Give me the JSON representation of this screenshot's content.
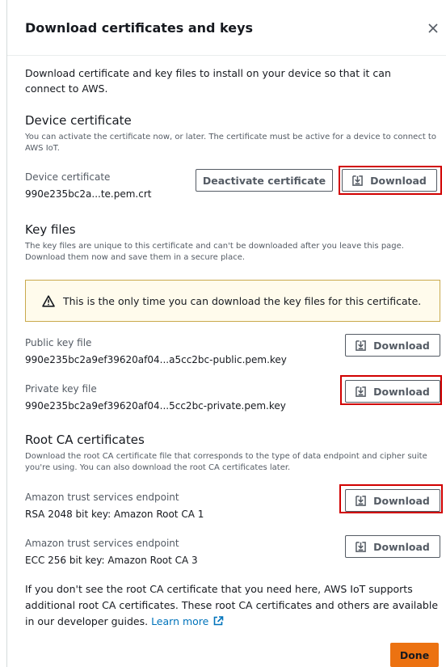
{
  "modal": {
    "title": "Download certificates and keys",
    "intro": "Download certificate and key files to install on your device so that it can connect to AWS."
  },
  "device_certificate": {
    "heading": "Device certificate",
    "description": "You can activate the certificate now, or later. The certificate must be active for a device to connect to AWS IoT.",
    "label": "Device certificate",
    "value": "990e235bc2a...te.pem.crt",
    "deactivate_label": "Deactivate certificate",
    "download_label": "Download"
  },
  "key_files": {
    "heading": "Key files",
    "description": "The key files are unique to this certificate and can't be downloaded after you leave this page. Download them now and save them in a secure place.",
    "alert": "This is the only time you can download the key files for this certificate.",
    "items": [
      {
        "label": "Public key file",
        "value": "990e235bc2a9ef39620af04...a5cc2bc-public.pem.key",
        "download_label": "Download"
      },
      {
        "label": "Private key file",
        "value": "990e235bc2a9ef39620af04...5cc2bc-private.pem.key",
        "download_label": "Download"
      }
    ]
  },
  "root_ca": {
    "heading": "Root CA certificates",
    "description": "Download the root CA certificate file that corresponds to the type of data endpoint and cipher suite you're using. You can also download the root CA certificates later.",
    "items": [
      {
        "label": "Amazon trust services endpoint",
        "value": "RSA 2048 bit key: Amazon Root CA 1",
        "download_label": "Download"
      },
      {
        "label": "Amazon trust services endpoint",
        "value": "ECC 256 bit key: Amazon Root CA 3",
        "download_label": "Download"
      }
    ]
  },
  "footer": {
    "text": "If you don't see the root CA certificate that you need here, AWS IoT supports additional root CA certificates. These root CA certificates and others are available in our developer guides.",
    "link": "Learn more",
    "done_label": "Done"
  },
  "colors": {
    "accent": "#ec7211",
    "link": "#0073bb",
    "highlight": "#d10000"
  },
  "icons": [
    "close-icon",
    "download-icon",
    "warning-icon",
    "external-link-icon"
  ]
}
